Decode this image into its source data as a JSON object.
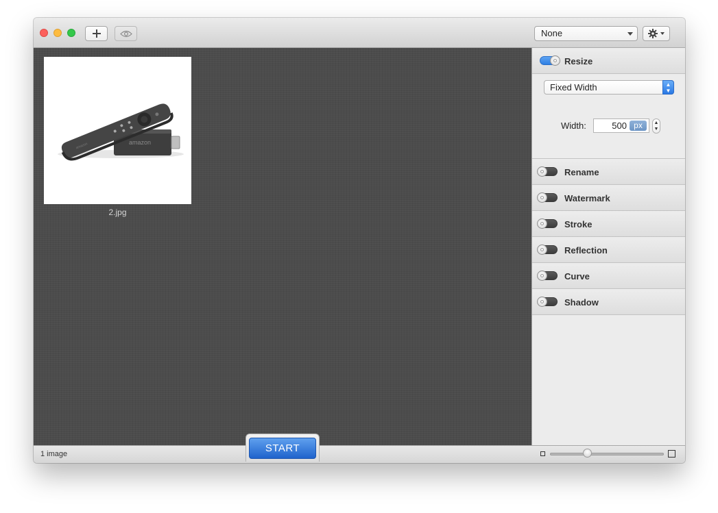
{
  "toolbar": {
    "add_icon": "plus-icon",
    "preview_icon": "eye-icon",
    "preset_value": "None",
    "settings_icon": "gear-icon"
  },
  "canvas": {
    "images": [
      {
        "filename": "2.jpg",
        "content": "amazon fire tv stick with remote"
      }
    ]
  },
  "panel": {
    "sections": [
      {
        "label": "Resize",
        "enabled": true
      },
      {
        "label": "Rename",
        "enabled": false
      },
      {
        "label": "Watermark",
        "enabled": false
      },
      {
        "label": "Stroke",
        "enabled": false
      },
      {
        "label": "Reflection",
        "enabled": false
      },
      {
        "label": "Curve",
        "enabled": false
      },
      {
        "label": "Shadow",
        "enabled": false
      }
    ],
    "resize": {
      "mode": "Fixed Width",
      "width_label": "Width:",
      "width_value": "500",
      "unit": "px"
    }
  },
  "bottombar": {
    "count": "1 image",
    "start_label": "START",
    "zoom": 0.33
  },
  "colors": {
    "accent": "#2f7fe3",
    "canvas_bg": "#4c4c4c",
    "panel_bg": "#ececec"
  }
}
